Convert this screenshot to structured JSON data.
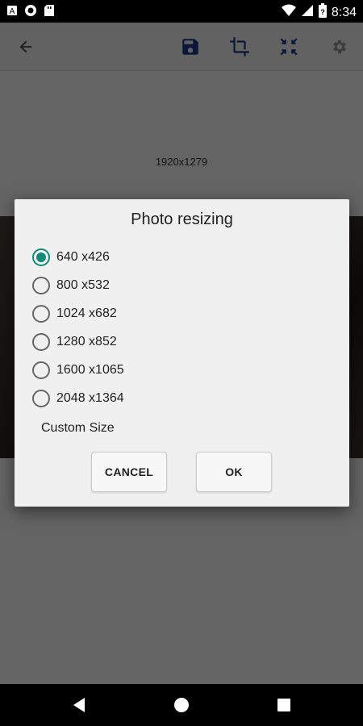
{
  "status_bar": {
    "time": "8:34",
    "left_icons": [
      "notification-icon",
      "record-icon",
      "sd-card-icon"
    ],
    "right_icons": [
      "wifi-icon",
      "signal-icon",
      "battery-icon"
    ]
  },
  "toolbar": {
    "back_icon": "arrow-left-icon",
    "save_icon": "save-icon",
    "crop_icon": "crop-icon",
    "resize_icon": "compress-icon",
    "settings_icon": "gear-icon"
  },
  "image": {
    "resolution": "1920x1279"
  },
  "dialog": {
    "title": "Photo resizing",
    "options": [
      {
        "label": "640 x426",
        "checked": true
      },
      {
        "label": "800 x532",
        "checked": false
      },
      {
        "label": "1024 x682",
        "checked": false
      },
      {
        "label": "1280 x852",
        "checked": false
      },
      {
        "label": "1600 x1065",
        "checked": false
      },
      {
        "label": "2048 x1364",
        "checked": false
      }
    ],
    "custom_size": "Custom Size",
    "cancel_label": "CANCEL",
    "ok_label": "OK"
  },
  "colors": {
    "accent": "#14897a",
    "toolbar_icon": "#1a3a8f"
  }
}
